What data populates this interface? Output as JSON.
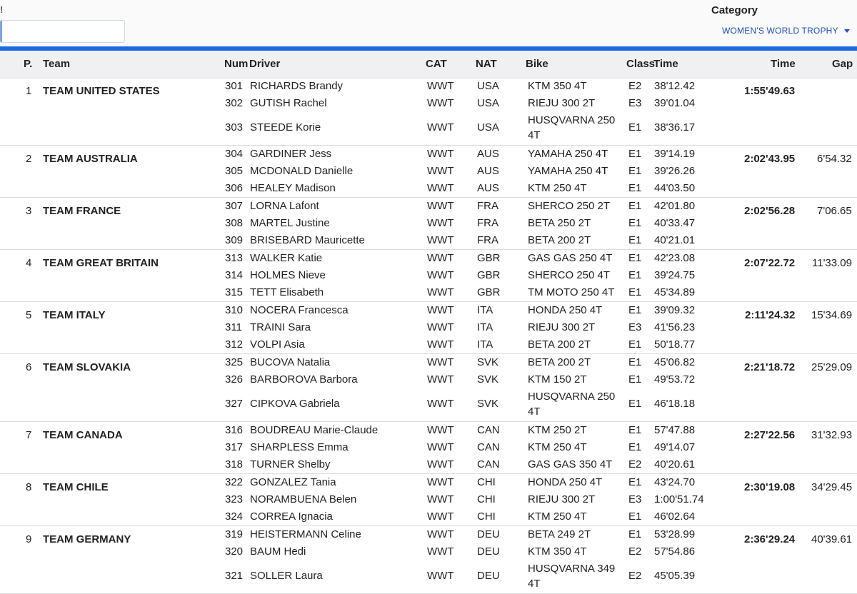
{
  "corner_char": "!",
  "category": {
    "label": "Category",
    "selected": "WOMEN'S WORLD TROPHY"
  },
  "columns": {
    "pos": "P.",
    "team": "Team",
    "num": "Num",
    "driver": "Driver",
    "cat": "CAT",
    "nat": "NAT",
    "bike": "Bike",
    "class": "Class",
    "time": "Time",
    "total_time": "Time",
    "gap": "Gap"
  },
  "teams": [
    {
      "pos": "1",
      "name": "TEAM UNITED STATES",
      "total": "1:55'49.63",
      "gap": "",
      "riders": [
        {
          "num": "301",
          "driver": "RICHARDS Brandy",
          "cat": "WWT",
          "nat": "USA",
          "bike": "KTM 350 4T",
          "class": "E2",
          "time": "38'12.42"
        },
        {
          "num": "302",
          "driver": "GUTISH Rachel",
          "cat": "WWT",
          "nat": "USA",
          "bike": "RIEJU 300 2T",
          "class": "E3",
          "time": "39'01.04"
        },
        {
          "num": "303",
          "driver": "STEEDE Korie",
          "cat": "WWT",
          "nat": "USA",
          "bike": "HUSQVARNA 250 4T",
          "class": "E1",
          "time": "38'36.17"
        }
      ]
    },
    {
      "pos": "2",
      "name": "TEAM AUSTRALIA",
      "total": "2:02'43.95",
      "gap": "6'54.32",
      "riders": [
        {
          "num": "304",
          "driver": "GARDINER Jess",
          "cat": "WWT",
          "nat": "AUS",
          "bike": "YAMAHA 250 4T",
          "class": "E1",
          "time": "39'14.19"
        },
        {
          "num": "305",
          "driver": "MCDONALD Danielle",
          "cat": "WWT",
          "nat": "AUS",
          "bike": "YAMAHA 250 4T",
          "class": "E1",
          "time": "39'26.26"
        },
        {
          "num": "306",
          "driver": "HEALEY Madison",
          "cat": "WWT",
          "nat": "AUS",
          "bike": "KTM 250 4T",
          "class": "E1",
          "time": "44'03.50"
        }
      ]
    },
    {
      "pos": "3",
      "name": "TEAM FRANCE",
      "total": "2:02'56.28",
      "gap": "7'06.65",
      "riders": [
        {
          "num": "307",
          "driver": "LORNA Lafont",
          "cat": "WWT",
          "nat": "FRA",
          "bike": "SHERCO 250 2T",
          "class": "E1",
          "time": "42'01.80"
        },
        {
          "num": "308",
          "driver": "MARTEL Justine",
          "cat": "WWT",
          "nat": "FRA",
          "bike": "BETA 250 2T",
          "class": "E1",
          "time": "40'33.47"
        },
        {
          "num": "309",
          "driver": "BRISEBARD Mauricette",
          "cat": "WWT",
          "nat": "FRA",
          "bike": "BETA 200 2T",
          "class": "E1",
          "time": "40'21.01"
        }
      ]
    },
    {
      "pos": "4",
      "name": "TEAM GREAT BRITAIN",
      "total": "2:07'22.72",
      "gap": "11'33.09",
      "riders": [
        {
          "num": "313",
          "driver": "WALKER Katie",
          "cat": "WWT",
          "nat": "GBR",
          "bike": "GAS GAS 250 4T",
          "class": "E1",
          "time": "42'23.08"
        },
        {
          "num": "314",
          "driver": "HOLMES Nieve",
          "cat": "WWT",
          "nat": "GBR",
          "bike": "SHERCO 250 4T",
          "class": "E1",
          "time": "39'24.75"
        },
        {
          "num": "315",
          "driver": "TETT Elisabeth",
          "cat": "WWT",
          "nat": "GBR",
          "bike": "TM MOTO 250 4T",
          "class": "E1",
          "time": "45'34.89"
        }
      ]
    },
    {
      "pos": "5",
      "name": "TEAM ITALY",
      "total": "2:11'24.32",
      "gap": "15'34.69",
      "riders": [
        {
          "num": "310",
          "driver": "NOCERA Francesca",
          "cat": "WWT",
          "nat": "ITA",
          "bike": "HONDA 250 4T",
          "class": "E1",
          "time": "39'09.32"
        },
        {
          "num": "311",
          "driver": "TRAINI Sara",
          "cat": "WWT",
          "nat": "ITA",
          "bike": "RIEJU 300 2T",
          "class": "E3",
          "time": "41'56.23"
        },
        {
          "num": "312",
          "driver": "VOLPI Asia",
          "cat": "WWT",
          "nat": "ITA",
          "bike": "BETA 200 2T",
          "class": "E1",
          "time": "50'18.77"
        }
      ]
    },
    {
      "pos": "6",
      "name": "TEAM SLOVAKIA",
      "total": "2:21'18.72",
      "gap": "25'29.09",
      "riders": [
        {
          "num": "325",
          "driver": "BUCOVA Natalia",
          "cat": "WWT",
          "nat": "SVK",
          "bike": "BETA 200 2T",
          "class": "E1",
          "time": "45'06.82"
        },
        {
          "num": "326",
          "driver": "BARBOROVA Barbora",
          "cat": "WWT",
          "nat": "SVK",
          "bike": "KTM 150 2T",
          "class": "E1",
          "time": "49'53.72"
        },
        {
          "num": "327",
          "driver": "CIPKOVA Gabriela",
          "cat": "WWT",
          "nat": "SVK",
          "bike": "HUSQVARNA 250 4T",
          "class": "E1",
          "time": "46'18.18"
        }
      ]
    },
    {
      "pos": "7",
      "name": "TEAM CANADA",
      "total": "2:27'22.56",
      "gap": "31'32.93",
      "riders": [
        {
          "num": "316",
          "driver": "BOUDREAU Marie-Claude",
          "cat": "WWT",
          "nat": "CAN",
          "bike": "KTM 250 2T",
          "class": "E1",
          "time": "57'47.88"
        },
        {
          "num": "317",
          "driver": "SHARPLESS Emma",
          "cat": "WWT",
          "nat": "CAN",
          "bike": "KTM 250 4T",
          "class": "E1",
          "time": "49'14.07"
        },
        {
          "num": "318",
          "driver": "TURNER Shelby",
          "cat": "WWT",
          "nat": "CAN",
          "bike": "GAS GAS 350 4T",
          "class": "E2",
          "time": "40'20.61"
        }
      ]
    },
    {
      "pos": "8",
      "name": "TEAM CHILE",
      "total": "2:30'19.08",
      "gap": "34'29.45",
      "riders": [
        {
          "num": "322",
          "driver": "GONZALEZ Tania",
          "cat": "WWT",
          "nat": "CHI",
          "bike": "HONDA 250 4T",
          "class": "E1",
          "time": "43'24.70"
        },
        {
          "num": "323",
          "driver": "NORAMBUENA Belen",
          "cat": "WWT",
          "nat": "CHI",
          "bike": "RIEJU 300 2T",
          "class": "E3",
          "time": "1:00'51.74"
        },
        {
          "num": "324",
          "driver": "CORREA Ignacia",
          "cat": "WWT",
          "nat": "CHI",
          "bike": "KTM 250 4T",
          "class": "E1",
          "time": "46'02.64"
        }
      ]
    },
    {
      "pos": "9",
      "name": "TEAM GERMANY",
      "total": "2:36'29.24",
      "gap": "40'39.61",
      "riders": [
        {
          "num": "319",
          "driver": "HEISTERMANN Celine",
          "cat": "WWT",
          "nat": "DEU",
          "bike": "BETA 249 2T",
          "class": "E1",
          "time": "53'28.99"
        },
        {
          "num": "320",
          "driver": "BAUM Hedi",
          "cat": "WWT",
          "nat": "DEU",
          "bike": "KTM 350 4T",
          "class": "E2",
          "time": "57'54.86"
        },
        {
          "num": "321",
          "driver": "SOLLER Laura",
          "cat": "WWT",
          "nat": "DEU",
          "bike": "HUSQVARNA 349 4T",
          "class": "E2",
          "time": "45'05.39"
        }
      ]
    }
  ]
}
